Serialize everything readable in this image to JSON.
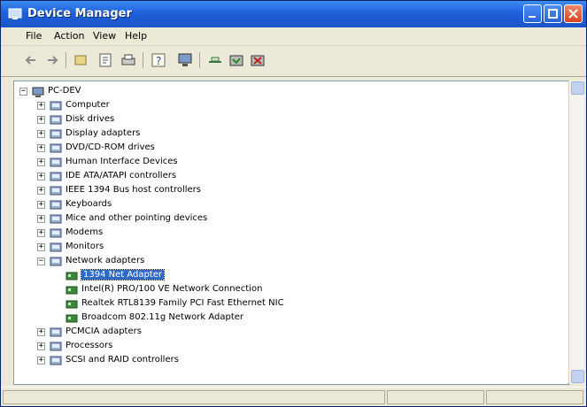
{
  "window": {
    "title": "Device Manager"
  },
  "menu": {
    "items": [
      "File",
      "Action",
      "View",
      "Help"
    ]
  },
  "toolbar": {
    "icons": [
      "back-icon",
      "forward-icon",
      "up-icon",
      "properties-icon",
      "print-icon",
      "help-icon",
      "monitor-icon",
      "scan-icon",
      "update-icon",
      "uninstall-icon"
    ]
  },
  "tree": {
    "root": "PC-DEV",
    "categories": [
      {
        "label": "Computer",
        "expander": "+"
      },
      {
        "label": "Disk drives",
        "expander": "+"
      },
      {
        "label": "Display adapters",
        "expander": "+"
      },
      {
        "label": "DVD/CD-ROM drives",
        "expander": "+"
      },
      {
        "label": "Human Interface Devices",
        "expander": "+"
      },
      {
        "label": "IDE ATA/ATAPI controllers",
        "expander": "+"
      },
      {
        "label": "IEEE 1394 Bus host controllers",
        "expander": "+"
      },
      {
        "label": "Keyboards",
        "expander": "+"
      },
      {
        "label": "Mice and other pointing devices",
        "expander": "+"
      },
      {
        "label": "Modems",
        "expander": "+"
      },
      {
        "label": "Monitors",
        "expander": "+"
      },
      {
        "label": "Network adapters",
        "expander": "−"
      },
      {
        "label": "1394 Net Adapter",
        "child": true,
        "selected": true
      },
      {
        "label": "Intel(R) PRO/100 VE Network Connection",
        "child": true
      },
      {
        "label": "Realtek RTL8139 Family PCI Fast Ethernet NIC",
        "child": true
      },
      {
        "label": "Broadcom 802.11g Network Adapter",
        "child": true
      },
      {
        "label": "PCMCIA adapters",
        "expander": "+"
      },
      {
        "label": "Processors",
        "expander": "+"
      },
      {
        "label": "SCSI and RAID controllers",
        "expander": "+"
      }
    ]
  },
  "colors": {
    "title_bar": "#1f5fd8",
    "selection": "#316ac5",
    "close_button": "#d8421d"
  }
}
